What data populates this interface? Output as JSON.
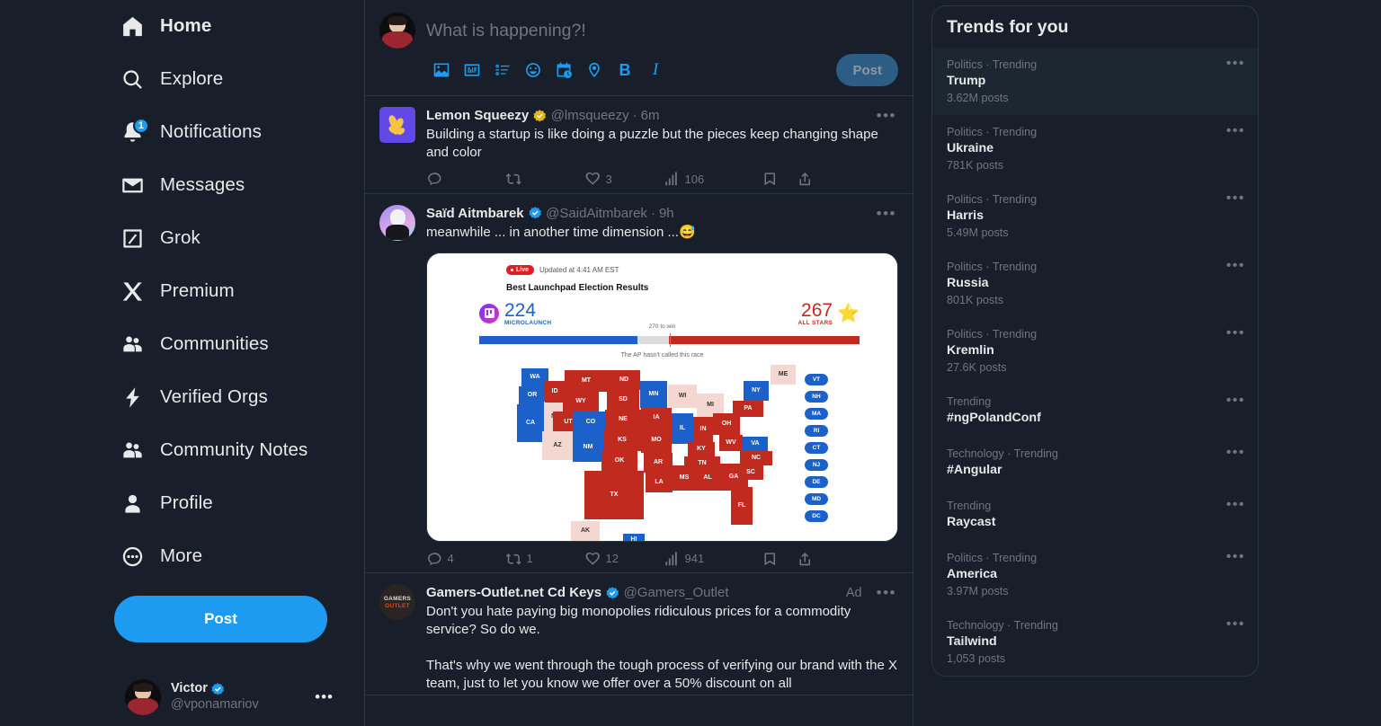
{
  "sidebar": {
    "items": [
      {
        "label": "Home",
        "icon": "home-icon",
        "active": true,
        "badge": null
      },
      {
        "label": "Explore",
        "icon": "search-icon",
        "active": false,
        "badge": null
      },
      {
        "label": "Notifications",
        "icon": "bell-icon",
        "active": false,
        "badge": "1"
      },
      {
        "label": "Messages",
        "icon": "envelope-icon",
        "active": false,
        "badge": null
      },
      {
        "label": "Grok",
        "icon": "grok-icon",
        "active": false,
        "badge": null
      },
      {
        "label": "Premium",
        "icon": "x-logo-icon",
        "active": false,
        "badge": null
      },
      {
        "label": "Communities",
        "icon": "communities-icon",
        "active": false,
        "badge": null
      },
      {
        "label": "Verified Orgs",
        "icon": "lightning-bolt-icon",
        "active": false,
        "badge": null
      },
      {
        "label": "Community Notes",
        "icon": "community-notes-icon",
        "active": false,
        "badge": null
      },
      {
        "label": "Profile",
        "icon": "person-icon",
        "active": false,
        "badge": null
      },
      {
        "label": "More",
        "icon": "more-circle-icon",
        "active": false,
        "badge": null
      }
    ],
    "post_button": "Post",
    "account": {
      "name": "Victor",
      "handle": "@vponamariov",
      "verified": true,
      "menu": "•••"
    }
  },
  "compose": {
    "placeholder": "What is happening?!",
    "post_label": "Post",
    "tools": [
      {
        "name": "media-image-icon",
        "title": "Media"
      },
      {
        "name": "gif-icon",
        "title": "GIF"
      },
      {
        "name": "poll-icon",
        "title": "Poll"
      },
      {
        "name": "emoji-icon",
        "title": "Emoji"
      },
      {
        "name": "schedule-icon",
        "title": "Schedule"
      },
      {
        "name": "location-icon",
        "title": "Location"
      },
      {
        "name": "bold-icon",
        "title": "B"
      },
      {
        "name": "italic-icon",
        "title": "I"
      }
    ]
  },
  "tweets": [
    {
      "name": "Lemon Squeezy",
      "handle": "@lmsqueezy",
      "time": "6m",
      "verified": "gold",
      "avatar": "lemon-squeezy-avatar",
      "text": "Building a startup is like doing a puzzle but the pieces keep changing shape and color",
      "replies": "",
      "reposts": "",
      "likes": "3",
      "views": "106",
      "ad": null
    },
    {
      "name": "Saïd Aitmbarek",
      "handle": "@SaidAitmbarek",
      "time": "9h",
      "verified": "blue",
      "avatar": "said-avatar",
      "text": "meanwhile ... in another time dimension ...😅",
      "replies": "4",
      "reposts": "1",
      "likes": "12",
      "views": "941",
      "ad": null
    },
    {
      "name": "Gamers-Outlet.net Cd Keys",
      "handle": "@Gamers_Outlet",
      "time": "",
      "verified": "blue",
      "avatar": "gamers-outlet-avatar",
      "text": "Don't you hate paying big monopolies ridiculous prices for a commodity service? So do we.\n\nThat's why we went through the tough process of verifying our brand with the X team, just to let you know we offer over a 50% discount on all",
      "replies": "",
      "reposts": "",
      "likes": "",
      "views": "",
      "ad": "Ad"
    }
  ],
  "election_card": {
    "live_label": "Live",
    "updated": "Updated at 4:41 AM EST",
    "title": "Best Launchpad Election Results",
    "left_score": "224",
    "left_party": "MICROLAUNCH",
    "right_score": "267",
    "right_party": "ALL STARS",
    "to_win": "270 to win",
    "footnote": "The AP hasn't called this race",
    "colors": {
      "blue": "#1b61c9",
      "red": "#c02a1f",
      "pink": "#f5d7d2"
    },
    "pills": [
      "VT",
      "NH",
      "MA",
      "RI",
      "CT",
      "NJ",
      "DE",
      "MD",
      "DC"
    ],
    "states": [
      {
        "ab": "WA",
        "color": "blue"
      },
      {
        "ab": "OR",
        "color": "blue"
      },
      {
        "ab": "CA",
        "color": "blue"
      },
      {
        "ab": "NV",
        "color": "pink"
      },
      {
        "ab": "ID",
        "color": "red"
      },
      {
        "ab": "MT",
        "color": "red"
      },
      {
        "ab": "WY",
        "color": "red"
      },
      {
        "ab": "UT",
        "color": "red"
      },
      {
        "ab": "AZ",
        "color": "pink"
      },
      {
        "ab": "CO",
        "color": "blue"
      },
      {
        "ab": "NM",
        "color": "blue"
      },
      {
        "ab": "ND",
        "color": "red"
      },
      {
        "ab": "SD",
        "color": "red"
      },
      {
        "ab": "NE",
        "color": "red"
      },
      {
        "ab": "KS",
        "color": "red"
      },
      {
        "ab": "OK",
        "color": "red"
      },
      {
        "ab": "TX",
        "color": "red"
      },
      {
        "ab": "MN",
        "color": "blue"
      },
      {
        "ab": "IA",
        "color": "red"
      },
      {
        "ab": "MO",
        "color": "red"
      },
      {
        "ab": "AR",
        "color": "red"
      },
      {
        "ab": "LA",
        "color": "red"
      },
      {
        "ab": "WI",
        "color": "pink"
      },
      {
        "ab": "IL",
        "color": "blue"
      },
      {
        "ab": "MS",
        "color": "red"
      },
      {
        "ab": "AL",
        "color": "red"
      },
      {
        "ab": "MI",
        "color": "pink"
      },
      {
        "ab": "IN",
        "color": "red"
      },
      {
        "ab": "KY",
        "color": "red"
      },
      {
        "ab": "TN",
        "color": "red"
      },
      {
        "ab": "GA",
        "color": "red"
      },
      {
        "ab": "OH",
        "color": "red"
      },
      {
        "ab": "WV",
        "color": "red"
      },
      {
        "ab": "VA",
        "color": "blue"
      },
      {
        "ab": "NC",
        "color": "red"
      },
      {
        "ab": "SC",
        "color": "red"
      },
      {
        "ab": "FL",
        "color": "red"
      },
      {
        "ab": "PA",
        "color": "red"
      },
      {
        "ab": "NY",
        "color": "blue"
      },
      {
        "ab": "ME",
        "color": "pink"
      },
      {
        "ab": "AK",
        "color": "pink"
      },
      {
        "ab": "HI",
        "color": "blue"
      }
    ]
  },
  "trends": {
    "header": "Trends for you",
    "items": [
      {
        "category": "Politics · Trending",
        "name": "Trump",
        "count": "3.62M posts",
        "highlight": true
      },
      {
        "category": "Politics · Trending",
        "name": "Ukraine",
        "count": "781K posts",
        "highlight": false
      },
      {
        "category": "Politics · Trending",
        "name": "Harris",
        "count": "5.49M posts",
        "highlight": false
      },
      {
        "category": "Politics · Trending",
        "name": "Russia",
        "count": "801K posts",
        "highlight": false
      },
      {
        "category": "Politics · Trending",
        "name": "Kremlin",
        "count": "27.6K posts",
        "highlight": false
      },
      {
        "category": "Trending",
        "name": "#ngPolandConf",
        "count": "",
        "highlight": false
      },
      {
        "category": "Technology · Trending",
        "name": "#Angular",
        "count": "",
        "highlight": false
      },
      {
        "category": "Trending",
        "name": "Raycast",
        "count": "",
        "highlight": false
      },
      {
        "category": "Politics · Trending",
        "name": "America",
        "count": "3.97M posts",
        "highlight": false
      },
      {
        "category": "Technology · Trending",
        "name": "Tailwind",
        "count": "1,053 posts",
        "highlight": false
      }
    ],
    "menu_glyph": "•••"
  },
  "theme": {
    "background": "#181f2a",
    "accent": "#1d9bf0",
    "border": "#2b3640",
    "muted_text": "#71767b",
    "text": "#e7e9ea"
  }
}
